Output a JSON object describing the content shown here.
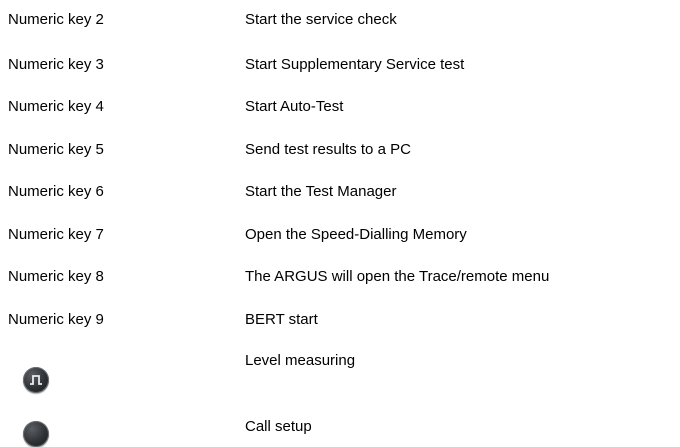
{
  "rows": [
    {
      "key": "Numeric key 2",
      "desc": "Start the service check"
    },
    {
      "key": "Numeric key 3",
      "desc": "Start Supplementary Service test"
    },
    {
      "key": "Numeric key 4",
      "desc": "Start Auto-Test"
    },
    {
      "key": "Numeric key 5",
      "desc": "Send test results to a PC"
    },
    {
      "key": "Numeric key 6",
      "desc": "Start the Test Manager"
    },
    {
      "key": "Numeric key 7",
      "desc": "Open the Speed-Dialling Memory"
    },
    {
      "key": "Numeric key 8",
      "desc": "The ARGUS will open the Trace/remote menu"
    },
    {
      "key": "Numeric key 9",
      "desc": "BERT start"
    }
  ],
  "icon_rows": [
    {
      "icon": "pulse-icon",
      "desc": "Level measuring"
    },
    {
      "icon": "call-setup-icon",
      "desc": "Call setup"
    }
  ]
}
